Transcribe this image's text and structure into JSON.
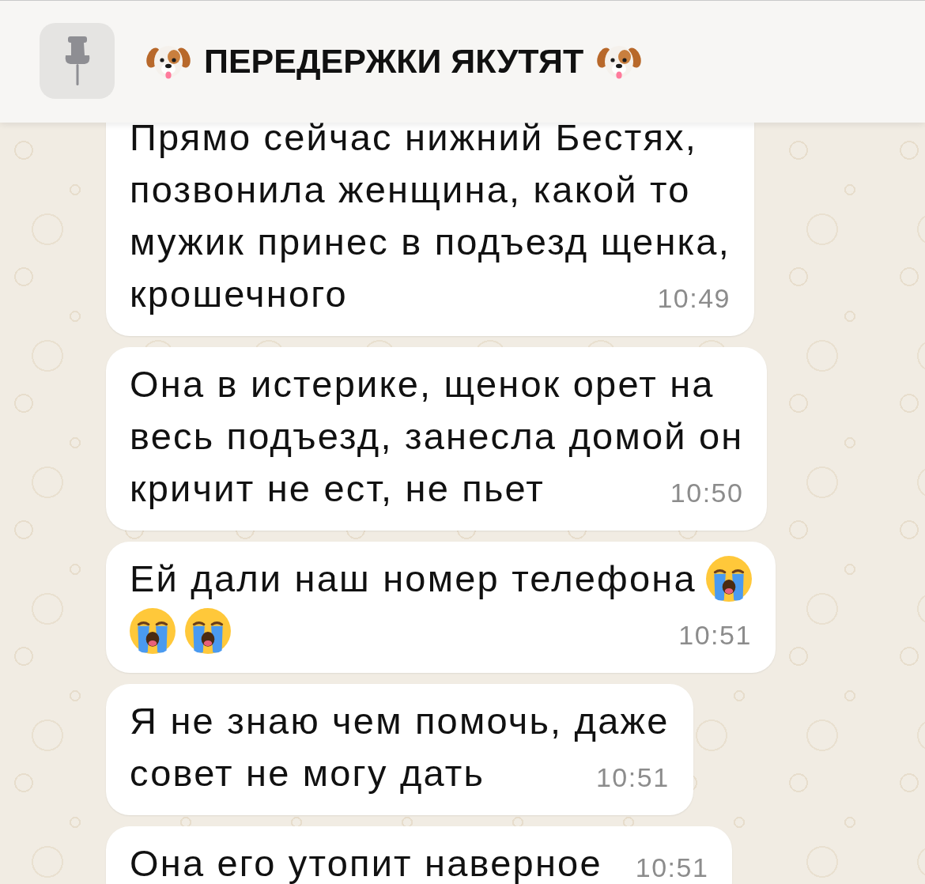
{
  "pinned": {
    "parts": [
      {
        "kind": "dog-emoji"
      },
      {
        "kind": "text",
        "text": "ПЕРЕДЕРЖКИ ЯКУТЯТ"
      },
      {
        "kind": "dog-emoji"
      }
    ]
  },
  "messages": [
    {
      "lines": [
        [
          {
            "kind": "text",
            "text": "Прямо сейчас нижний Бестях,"
          }
        ],
        [
          {
            "kind": "text",
            "text": "позвонила женщина, какой то"
          }
        ],
        [
          {
            "kind": "text",
            "text": "мужик принес в подъезд щенка,"
          }
        ],
        [
          {
            "kind": "text",
            "text": "крошечного"
          }
        ]
      ],
      "time": "10:49"
    },
    {
      "lines": [
        [
          {
            "kind": "text",
            "text": "Она в истерике, щенок орет на"
          }
        ],
        [
          {
            "kind": "text",
            "text": "весь подъезд, занесла домой он"
          }
        ],
        [
          {
            "kind": "text",
            "text": "кричит не ест, не пьет"
          }
        ]
      ],
      "time": "10:50"
    },
    {
      "lines": [
        [
          {
            "kind": "text",
            "text": "Ей дали наш номер телефона"
          },
          {
            "kind": "crying-emoji"
          }
        ],
        [
          {
            "kind": "crying-emoji"
          },
          {
            "kind": "crying-emoji"
          }
        ]
      ],
      "time": "10:51"
    },
    {
      "lines": [
        [
          {
            "kind": "text",
            "text": "Я не знаю чем помочь, даже"
          }
        ],
        [
          {
            "kind": "text",
            "text": "совет не могу дать"
          }
        ]
      ],
      "time": "10:51"
    },
    {
      "lines": [
        [
          {
            "kind": "text",
            "text": "Она его утопит наверное"
          }
        ]
      ],
      "time": "10:51"
    }
  ]
}
